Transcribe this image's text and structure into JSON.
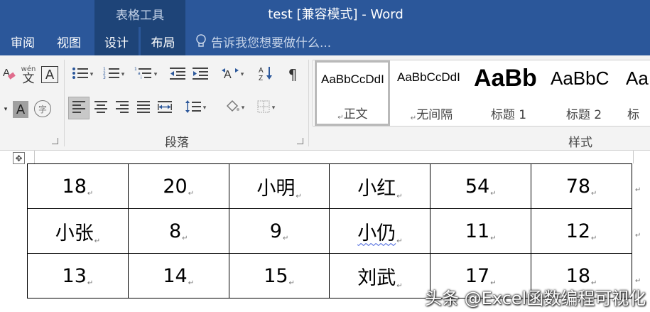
{
  "titlebar": {
    "context_tab": "表格工具",
    "doc_title": "test [兼容模式] - Word"
  },
  "tabs": {
    "review": "审阅",
    "view": "视图",
    "design": "设计",
    "layout": "布局",
    "tell_me": "告诉我您想要做什么..."
  },
  "ribbon": {
    "font_group": {
      "phonetic_label": "wén",
      "phonetic_char": "文",
      "char_border": "A",
      "shading": "A",
      "enclosed_char": "字"
    },
    "paragraph_group": {
      "label": "段落",
      "sort_label": "A Z"
    },
    "styles_group": {
      "label": "样式",
      "items": [
        {
          "sample": "AaBbCcDdI",
          "name": "正文"
        },
        {
          "sample": "AaBbCcDdI",
          "name": "无间隔"
        },
        {
          "sample": "AaBb",
          "name": "标题 1"
        },
        {
          "sample": "AaBbC",
          "name": "标题 2"
        },
        {
          "sample": "Aa",
          "name": "标"
        }
      ]
    }
  },
  "table": {
    "rows": [
      [
        "18",
        "20",
        "小明",
        "小红",
        "54",
        "78"
      ],
      [
        "小张",
        "8",
        "9",
        "小仍",
        "11",
        "12"
      ],
      [
        "13",
        "14",
        "15",
        "刘武",
        "17",
        "18"
      ]
    ]
  },
  "watermark": "头条 @Excel函数编程可视化",
  "colors": {
    "ribbon_blue": "#2b579a",
    "context_blue": "#1e4478",
    "ribbon_bg": "#f3f3f3"
  }
}
